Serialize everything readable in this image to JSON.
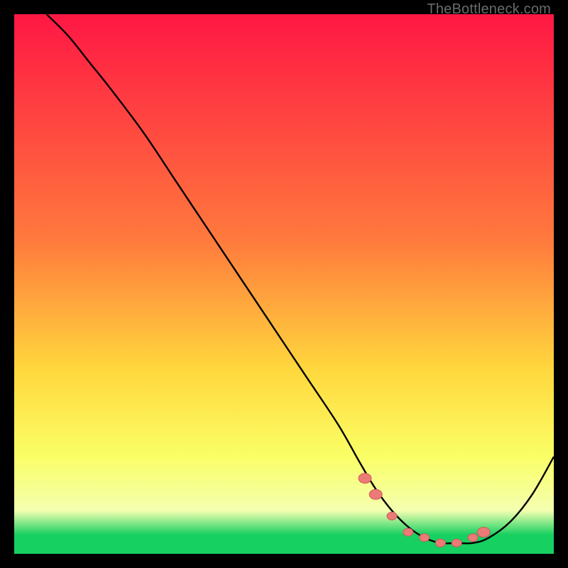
{
  "watermark": "TheBottleneck.com",
  "colors": {
    "top": "#ff1744",
    "mid_upper": "#ff7a3d",
    "mid": "#ffd83d",
    "mid_lower": "#faff66",
    "pale": "#f4ffb0",
    "green": "#16d061",
    "curve": "#000000",
    "marker_fill": "#ec7a77",
    "marker_stroke": "#c95c59"
  },
  "chart_data": {
    "type": "line",
    "title": "",
    "xlabel": "",
    "ylabel": "",
    "xlim": [
      0,
      100
    ],
    "ylim": [
      0,
      100
    ],
    "series": [
      {
        "name": "bottleneck-curve",
        "x": [
          6,
          10,
          14,
          18,
          24,
          30,
          36,
          42,
          48,
          54,
          60,
          64,
          67,
          70,
          73,
          76,
          79,
          82,
          85,
          88,
          92,
          96,
          100
        ],
        "y": [
          100,
          96,
          91,
          86,
          78,
          69,
          60,
          51,
          42,
          33,
          24,
          17,
          12,
          8,
          5,
          3,
          2,
          2,
          2,
          3,
          6,
          11,
          18
        ]
      }
    ],
    "markers": {
      "name": "highlight-points",
      "x": [
        65,
        67,
        70,
        73,
        76,
        79,
        82,
        85,
        87
      ],
      "y": [
        14,
        11,
        7,
        4,
        3,
        2,
        2,
        3,
        4
      ]
    },
    "gradient_stops": [
      {
        "offset": 0.0,
        "key": "top"
      },
      {
        "offset": 0.42,
        "key": "mid_upper"
      },
      {
        "offset": 0.66,
        "key": "mid"
      },
      {
        "offset": 0.82,
        "key": "mid_lower"
      },
      {
        "offset": 0.92,
        "key": "pale"
      },
      {
        "offset": 0.965,
        "key": "green"
      },
      {
        "offset": 1.0,
        "key": "green"
      }
    ]
  }
}
